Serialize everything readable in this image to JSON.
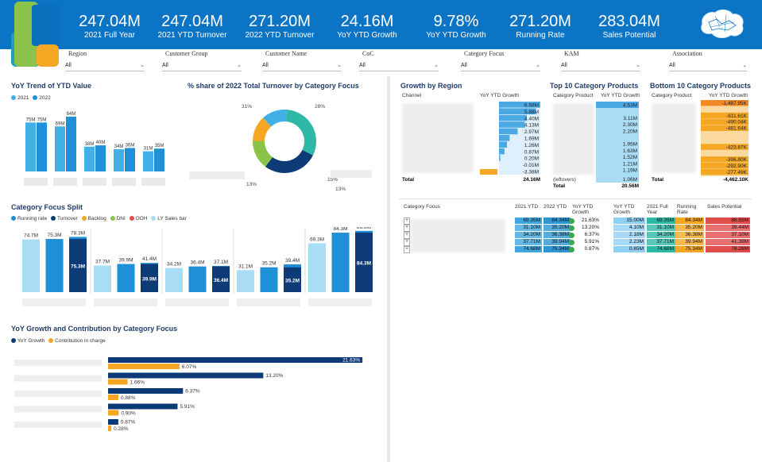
{
  "kpis": [
    {
      "value": "247.04M",
      "label": "2021 Full Year"
    },
    {
      "value": "247.04M",
      "label": "2021 YTD Turnover"
    },
    {
      "value": "271.20M",
      "label": "2022 YTD Turnover"
    },
    {
      "value": "24.16M",
      "label": "YoY YTD Growth"
    },
    {
      "value": "9.78%",
      "label": "YoY YTD Growth"
    },
    {
      "value": "271.20M",
      "label": "Running Rate"
    },
    {
      "value": "283.04M",
      "label": "Sales Potential"
    }
  ],
  "filters": [
    {
      "label": "Region",
      "value": "All"
    },
    {
      "label": "Customer Group",
      "value": "All"
    },
    {
      "label": "Customer Name",
      "value": "All"
    },
    {
      "label": "CoC",
      "value": "All"
    },
    {
      "label": "Category Focus",
      "value": "All"
    },
    {
      "label": "KAM",
      "value": "All"
    },
    {
      "label": "Association",
      "value": "All"
    }
  ],
  "colors": {
    "banner": "#0b74c4",
    "light_blue": "#41b0e6",
    "mid_blue": "#1f8fd8",
    "navy": "#0d3b78",
    "orange": "#f5a623",
    "green": "#8bc34a",
    "teal": "#2eb8a6",
    "red": "#e04b4b"
  },
  "yoy_trend": {
    "title": "YoY Trend of YTD Value",
    "legend": [
      "2021",
      "2022"
    ],
    "chart_data": {
      "type": "bar",
      "series": [
        {
          "name": "2021",
          "values": [
            75,
            69,
            38,
            34,
            31
          ]
        },
        {
          "name": "2022",
          "values": [
            75,
            84,
            40,
            36,
            35
          ]
        }
      ],
      "labels": [
        [
          "75M",
          "75M"
        ],
        [
          "69M",
          "84M"
        ],
        [
          "38M",
          "40M"
        ],
        [
          "34M",
          "36M"
        ],
        [
          "31M",
          "35M"
        ]
      ],
      "ylim": [
        0,
        90
      ]
    }
  },
  "share": {
    "title": "% share of 2022 Total Turnover by Category Focus",
    "chart_data": {
      "type": "pie",
      "values": [
        31,
        28,
        15,
        13,
        13
      ],
      "labels": [
        "31%",
        "28%",
        "15%",
        "13%",
        "13%"
      ]
    }
  },
  "split": {
    "title": "Category Focus Split",
    "legend": [
      "Running rate",
      "Turnover",
      "Backlog",
      "DNI",
      "OOH",
      "LY Sales bar"
    ],
    "chart_data": {
      "type": "bar",
      "top_labels": [
        "74.7M",
        "75.3M",
        "78.3M",
        "37.7M",
        "39.9M",
        "41.4M",
        "34.2M",
        "36.4M",
        "37.1M",
        "31.1M",
        "35.2M",
        "39.4M",
        "69.3M",
        "84.3M",
        "86.8M"
      ],
      "values": [
        74.7,
        75.3,
        78.3,
        37.7,
        39.9,
        41.4,
        34.2,
        36.4,
        37.1,
        31.1,
        35.2,
        39.4,
        69.3,
        84.3,
        86.8
      ],
      "inner": [
        null,
        null,
        "75.3M",
        null,
        null,
        "39.9M",
        null,
        null,
        "36.4M",
        null,
        null,
        "35.2M",
        null,
        null,
        "84.3M"
      ],
      "inner_values": [
        null,
        null,
        75.3,
        null,
        null,
        39.9,
        null,
        null,
        36.4,
        null,
        null,
        35.2,
        null,
        null,
        84.3
      ],
      "ylim": [
        0,
        90
      ]
    }
  },
  "growth_contrib": {
    "title": "YoY Growth and Contribution by Category Focus",
    "legend": [
      "YoY Growth",
      "Contribution in charge"
    ],
    "chart_data": {
      "type": "bar",
      "yoy": [
        21.63,
        13.2,
        6.37,
        5.91,
        0.87
      ],
      "yoy_labels": [
        "21.63%",
        "13.20%",
        "6.37%",
        "5.91%",
        "0.87%"
      ],
      "contrib": [
        6.07,
        1.66,
        0.88,
        0.9,
        0.28
      ],
      "contrib_labels": [
        "6.07%",
        "1.66%",
        "0.88%",
        "0.90%",
        "0.28%"
      ]
    }
  },
  "region": {
    "title": "Growth by Region",
    "col1": "Channel",
    "col2": "YoY YTD Growth",
    "values": [
      "6.58M",
      "5.88M",
      "4.40M",
      "4.13M",
      "2.97M",
      "1.69M",
      "1.26M",
      "0.87M",
      "0.20M",
      "-0.01M",
      "-3.38M"
    ],
    "total_label": "Total",
    "total": "24.16M"
  },
  "top10": {
    "title": "Top 10 Category Products",
    "col1": "Category Product",
    "col2": "YoY YTD Growth",
    "values": [
      "4.53M",
      "3.11M",
      "2.30M",
      "2.20M",
      "1.95M",
      "1.63M",
      "1.52M",
      "1.21M",
      "1.19M"
    ],
    "others_label": "(leftovers)",
    "others": "1.06M",
    "total_label": "Total",
    "total": "20.56M"
  },
  "bottom10": {
    "title": "Bottom 10 Category Products",
    "col1": "Category Product",
    "col2": "YoY YTD Growth",
    "values": [
      "-1,487.95K",
      "-611.61K",
      "-490.04K",
      "-481.64K",
      "-423.87K",
      "-396.80K",
      "-292.90K",
      "-277.49K"
    ],
    "total_label": "Total",
    "total": "-4,462.10K"
  },
  "matrix": {
    "headers": [
      "Category Focus",
      "2021 YTD",
      "2022 YTD",
      "YoY YTD Growth",
      "YoY YTD Growth",
      "2021 Full Year",
      "Running Rate",
      "Sales Potential"
    ],
    "rows": [
      [
        "69.35M",
        "84.34M",
        "21.63%",
        "15.00M",
        "69.35M",
        "84.34M",
        "86.55M"
      ],
      [
        "31.10M",
        "35.20M",
        "13.20%",
        "4.10M",
        "31.10M",
        "35.20M",
        "39.44M"
      ],
      [
        "34.20M",
        "36.38M",
        "6.37%",
        "2.18M",
        "34.20M",
        "36.38M",
        "37.10M"
      ],
      [
        "37.71M",
        "39.94M",
        "5.91%",
        "2.23M",
        "37.71M",
        "39.94M",
        "41.39M"
      ],
      [
        "74.68M",
        "75.34M",
        "0.87%",
        "0.65M",
        "74.68M",
        "75.34M",
        "78.26M"
      ]
    ]
  }
}
